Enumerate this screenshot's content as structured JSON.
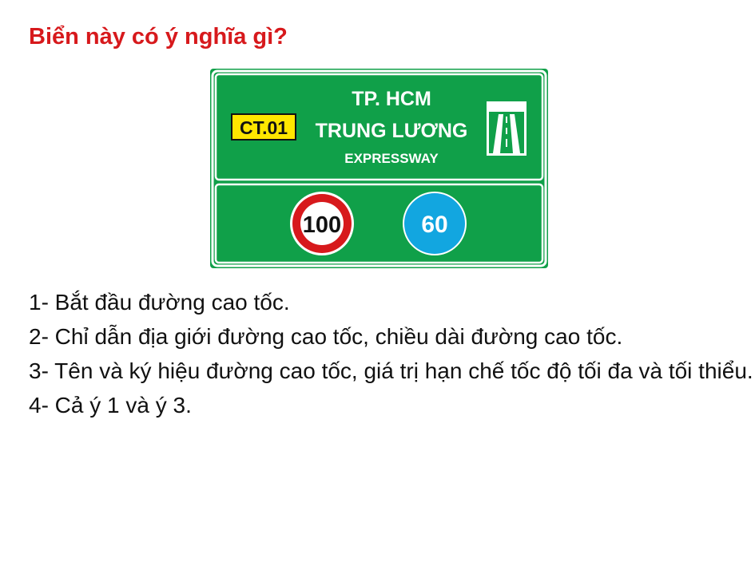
{
  "question": "Biển này có ý nghĩa gì?",
  "sign": {
    "route_code": "CT.01",
    "destination_1": "TP. HCM",
    "destination_2": "TRUNG LƯƠNG",
    "road_type": "EXPRESSWAY",
    "max_speed": "100",
    "min_speed": "60",
    "icon": "expressway-icon",
    "colors": {
      "panel": "#10a049",
      "route_badge": "#ffe600",
      "max_speed_ring": "#d7191c",
      "min_speed_disc": "#12a6e0"
    }
  },
  "answers": [
    "1- Bắt đầu đường cao tốc.",
    "2- Chỉ dẫn địa giới đường cao tốc, chiều dài đường cao tốc.",
    "3- Tên và ký hiệu đường cao tốc, giá trị hạn chế tốc độ tối đa và tối thiểu.",
    "4- Cả ý 1 và ý 3."
  ]
}
